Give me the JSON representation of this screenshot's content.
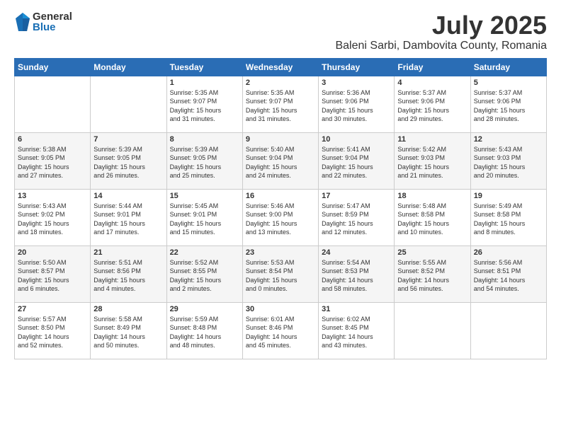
{
  "logo": {
    "general": "General",
    "blue": "Blue"
  },
  "title": {
    "month_year": "July 2025",
    "location": "Baleni Sarbi, Dambovita County, Romania"
  },
  "weekdays": [
    "Sunday",
    "Monday",
    "Tuesday",
    "Wednesday",
    "Thursday",
    "Friday",
    "Saturday"
  ],
  "weeks": [
    [
      {
        "day": "",
        "content": ""
      },
      {
        "day": "",
        "content": ""
      },
      {
        "day": "1",
        "content": "Sunrise: 5:35 AM\nSunset: 9:07 PM\nDaylight: 15 hours\nand 31 minutes."
      },
      {
        "day": "2",
        "content": "Sunrise: 5:35 AM\nSunset: 9:07 PM\nDaylight: 15 hours\nand 31 minutes."
      },
      {
        "day": "3",
        "content": "Sunrise: 5:36 AM\nSunset: 9:06 PM\nDaylight: 15 hours\nand 30 minutes."
      },
      {
        "day": "4",
        "content": "Sunrise: 5:37 AM\nSunset: 9:06 PM\nDaylight: 15 hours\nand 29 minutes."
      },
      {
        "day": "5",
        "content": "Sunrise: 5:37 AM\nSunset: 9:06 PM\nDaylight: 15 hours\nand 28 minutes."
      }
    ],
    [
      {
        "day": "6",
        "content": "Sunrise: 5:38 AM\nSunset: 9:05 PM\nDaylight: 15 hours\nand 27 minutes."
      },
      {
        "day": "7",
        "content": "Sunrise: 5:39 AM\nSunset: 9:05 PM\nDaylight: 15 hours\nand 26 minutes."
      },
      {
        "day": "8",
        "content": "Sunrise: 5:39 AM\nSunset: 9:05 PM\nDaylight: 15 hours\nand 25 minutes."
      },
      {
        "day": "9",
        "content": "Sunrise: 5:40 AM\nSunset: 9:04 PM\nDaylight: 15 hours\nand 24 minutes."
      },
      {
        "day": "10",
        "content": "Sunrise: 5:41 AM\nSunset: 9:04 PM\nDaylight: 15 hours\nand 22 minutes."
      },
      {
        "day": "11",
        "content": "Sunrise: 5:42 AM\nSunset: 9:03 PM\nDaylight: 15 hours\nand 21 minutes."
      },
      {
        "day": "12",
        "content": "Sunrise: 5:43 AM\nSunset: 9:03 PM\nDaylight: 15 hours\nand 20 minutes."
      }
    ],
    [
      {
        "day": "13",
        "content": "Sunrise: 5:43 AM\nSunset: 9:02 PM\nDaylight: 15 hours\nand 18 minutes."
      },
      {
        "day": "14",
        "content": "Sunrise: 5:44 AM\nSunset: 9:01 PM\nDaylight: 15 hours\nand 17 minutes."
      },
      {
        "day": "15",
        "content": "Sunrise: 5:45 AM\nSunset: 9:01 PM\nDaylight: 15 hours\nand 15 minutes."
      },
      {
        "day": "16",
        "content": "Sunrise: 5:46 AM\nSunset: 9:00 PM\nDaylight: 15 hours\nand 13 minutes."
      },
      {
        "day": "17",
        "content": "Sunrise: 5:47 AM\nSunset: 8:59 PM\nDaylight: 15 hours\nand 12 minutes."
      },
      {
        "day": "18",
        "content": "Sunrise: 5:48 AM\nSunset: 8:58 PM\nDaylight: 15 hours\nand 10 minutes."
      },
      {
        "day": "19",
        "content": "Sunrise: 5:49 AM\nSunset: 8:58 PM\nDaylight: 15 hours\nand 8 minutes."
      }
    ],
    [
      {
        "day": "20",
        "content": "Sunrise: 5:50 AM\nSunset: 8:57 PM\nDaylight: 15 hours\nand 6 minutes."
      },
      {
        "day": "21",
        "content": "Sunrise: 5:51 AM\nSunset: 8:56 PM\nDaylight: 15 hours\nand 4 minutes."
      },
      {
        "day": "22",
        "content": "Sunrise: 5:52 AM\nSunset: 8:55 PM\nDaylight: 15 hours\nand 2 minutes."
      },
      {
        "day": "23",
        "content": "Sunrise: 5:53 AM\nSunset: 8:54 PM\nDaylight: 15 hours\nand 0 minutes."
      },
      {
        "day": "24",
        "content": "Sunrise: 5:54 AM\nSunset: 8:53 PM\nDaylight: 14 hours\nand 58 minutes."
      },
      {
        "day": "25",
        "content": "Sunrise: 5:55 AM\nSunset: 8:52 PM\nDaylight: 14 hours\nand 56 minutes."
      },
      {
        "day": "26",
        "content": "Sunrise: 5:56 AM\nSunset: 8:51 PM\nDaylight: 14 hours\nand 54 minutes."
      }
    ],
    [
      {
        "day": "27",
        "content": "Sunrise: 5:57 AM\nSunset: 8:50 PM\nDaylight: 14 hours\nand 52 minutes."
      },
      {
        "day": "28",
        "content": "Sunrise: 5:58 AM\nSunset: 8:49 PM\nDaylight: 14 hours\nand 50 minutes."
      },
      {
        "day": "29",
        "content": "Sunrise: 5:59 AM\nSunset: 8:48 PM\nDaylight: 14 hours\nand 48 minutes."
      },
      {
        "day": "30",
        "content": "Sunrise: 6:01 AM\nSunset: 8:46 PM\nDaylight: 14 hours\nand 45 minutes."
      },
      {
        "day": "31",
        "content": "Sunrise: 6:02 AM\nSunset: 8:45 PM\nDaylight: 14 hours\nand 43 minutes."
      },
      {
        "day": "",
        "content": ""
      },
      {
        "day": "",
        "content": ""
      }
    ]
  ]
}
